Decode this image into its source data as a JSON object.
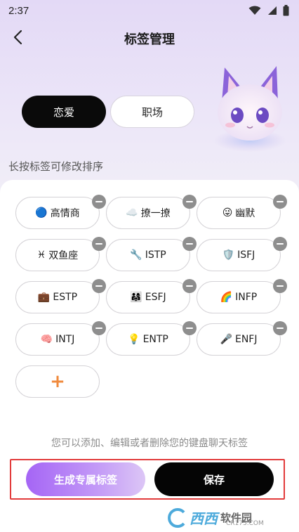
{
  "status_bar": {
    "time": "2:37"
  },
  "header": {
    "title": "标签管理"
  },
  "tabs": [
    {
      "label": "恋爱",
      "active": true
    },
    {
      "label": "职场",
      "active": false
    }
  ],
  "hint_top": "长按标签可修改排序",
  "tags": [
    {
      "emoji": "🔵",
      "label": "高情商"
    },
    {
      "emoji": "☁️",
      "label": "撩一撩"
    },
    {
      "emoji": "😜",
      "label": "幽默"
    },
    {
      "emoji": "♓",
      "label": "双鱼座"
    },
    {
      "emoji": "🔧",
      "label": "ISTP"
    },
    {
      "emoji": "🛡️",
      "label": "ISFJ"
    },
    {
      "emoji": "💼",
      "label": "ESTP"
    },
    {
      "emoji": "👨‍👩‍👧",
      "label": "ESFJ"
    },
    {
      "emoji": "🌈",
      "label": "INFP"
    },
    {
      "emoji": "🧠",
      "label": "INTJ"
    },
    {
      "emoji": "💡",
      "label": "ENTP"
    },
    {
      "emoji": "🎤",
      "label": "ENFJ"
    }
  ],
  "add_tag": {
    "symbol": "+"
  },
  "footer_hint": "您可以添加、编辑或者删除您的键盘聊天标签",
  "actions": {
    "generate_label": "生成专属标签",
    "save_label": "保存"
  },
  "watermark": {
    "brand": "西西",
    "name": "软件园",
    "domain": "CR173.COM"
  },
  "colors": {
    "accent_orange": "#f08a3c",
    "highlight_red": "#e23b3b",
    "gradient_purple": "#a565f5"
  }
}
